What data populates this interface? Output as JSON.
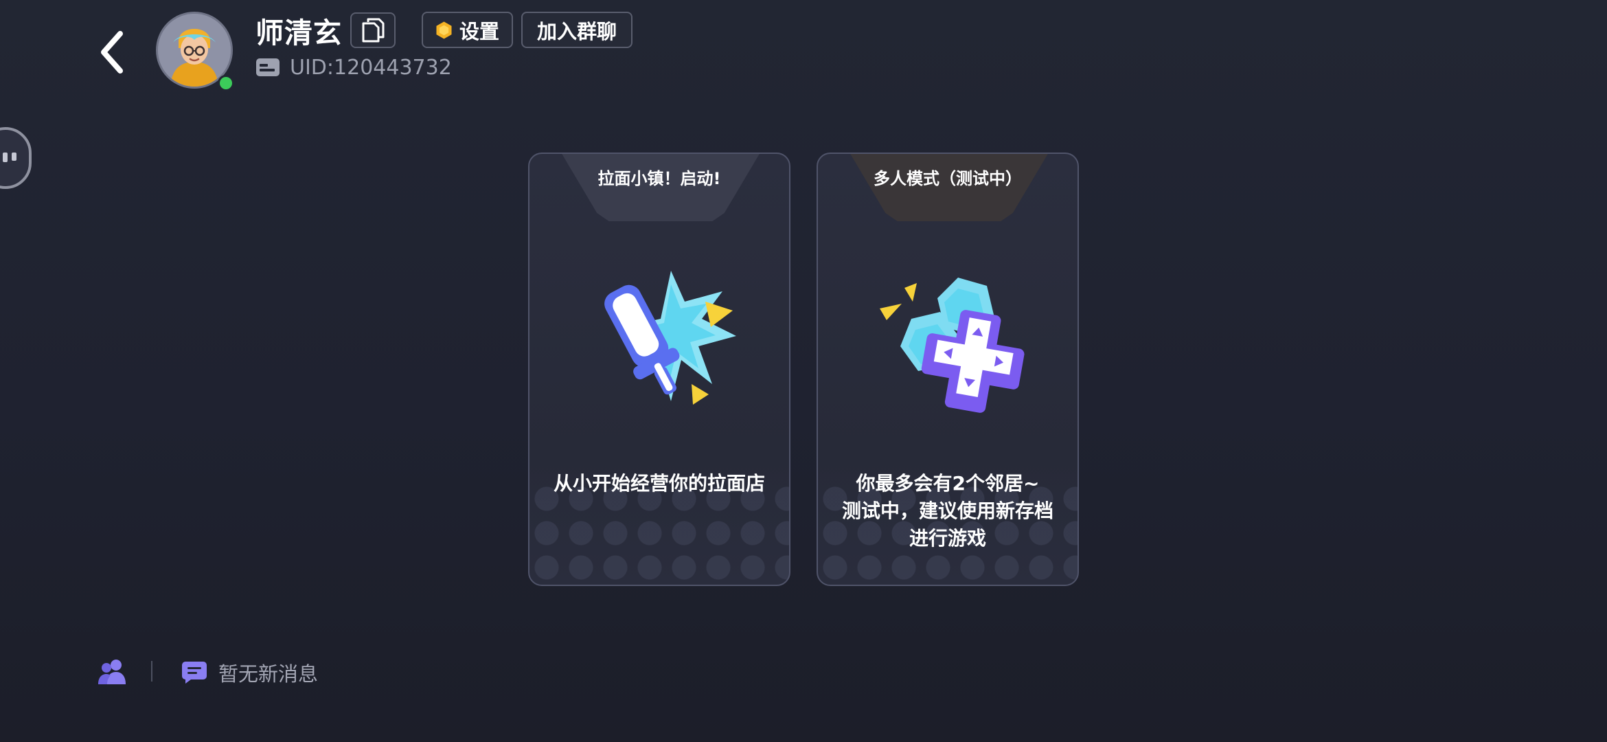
{
  "header": {
    "username": "师清玄",
    "uid": "UID:120443732",
    "settings_label": "设置",
    "join_group_label": "加入群聊",
    "online_status_color": "#3ccc5a"
  },
  "cards": [
    {
      "title": "拉面小镇！启动!",
      "description_lines": [
        "从小开始经营你的拉面店"
      ],
      "icon": "sword-burst-icon"
    },
    {
      "title": "多人模式（测试中）",
      "description_lines": [
        "你最多会有2个邻居~",
        "测试中，建议使用新存档",
        "进行游戏"
      ],
      "icon": "gamepad-hexagon-icon"
    }
  ],
  "footer": {
    "message_status": "暂无新消息"
  },
  "colors": {
    "background": "#222633",
    "accent_purple": "#7b5cf0",
    "accent_cyan": "#5fd6f0",
    "accent_yellow": "#f7d23a",
    "settings_coin": "#f5b324"
  }
}
